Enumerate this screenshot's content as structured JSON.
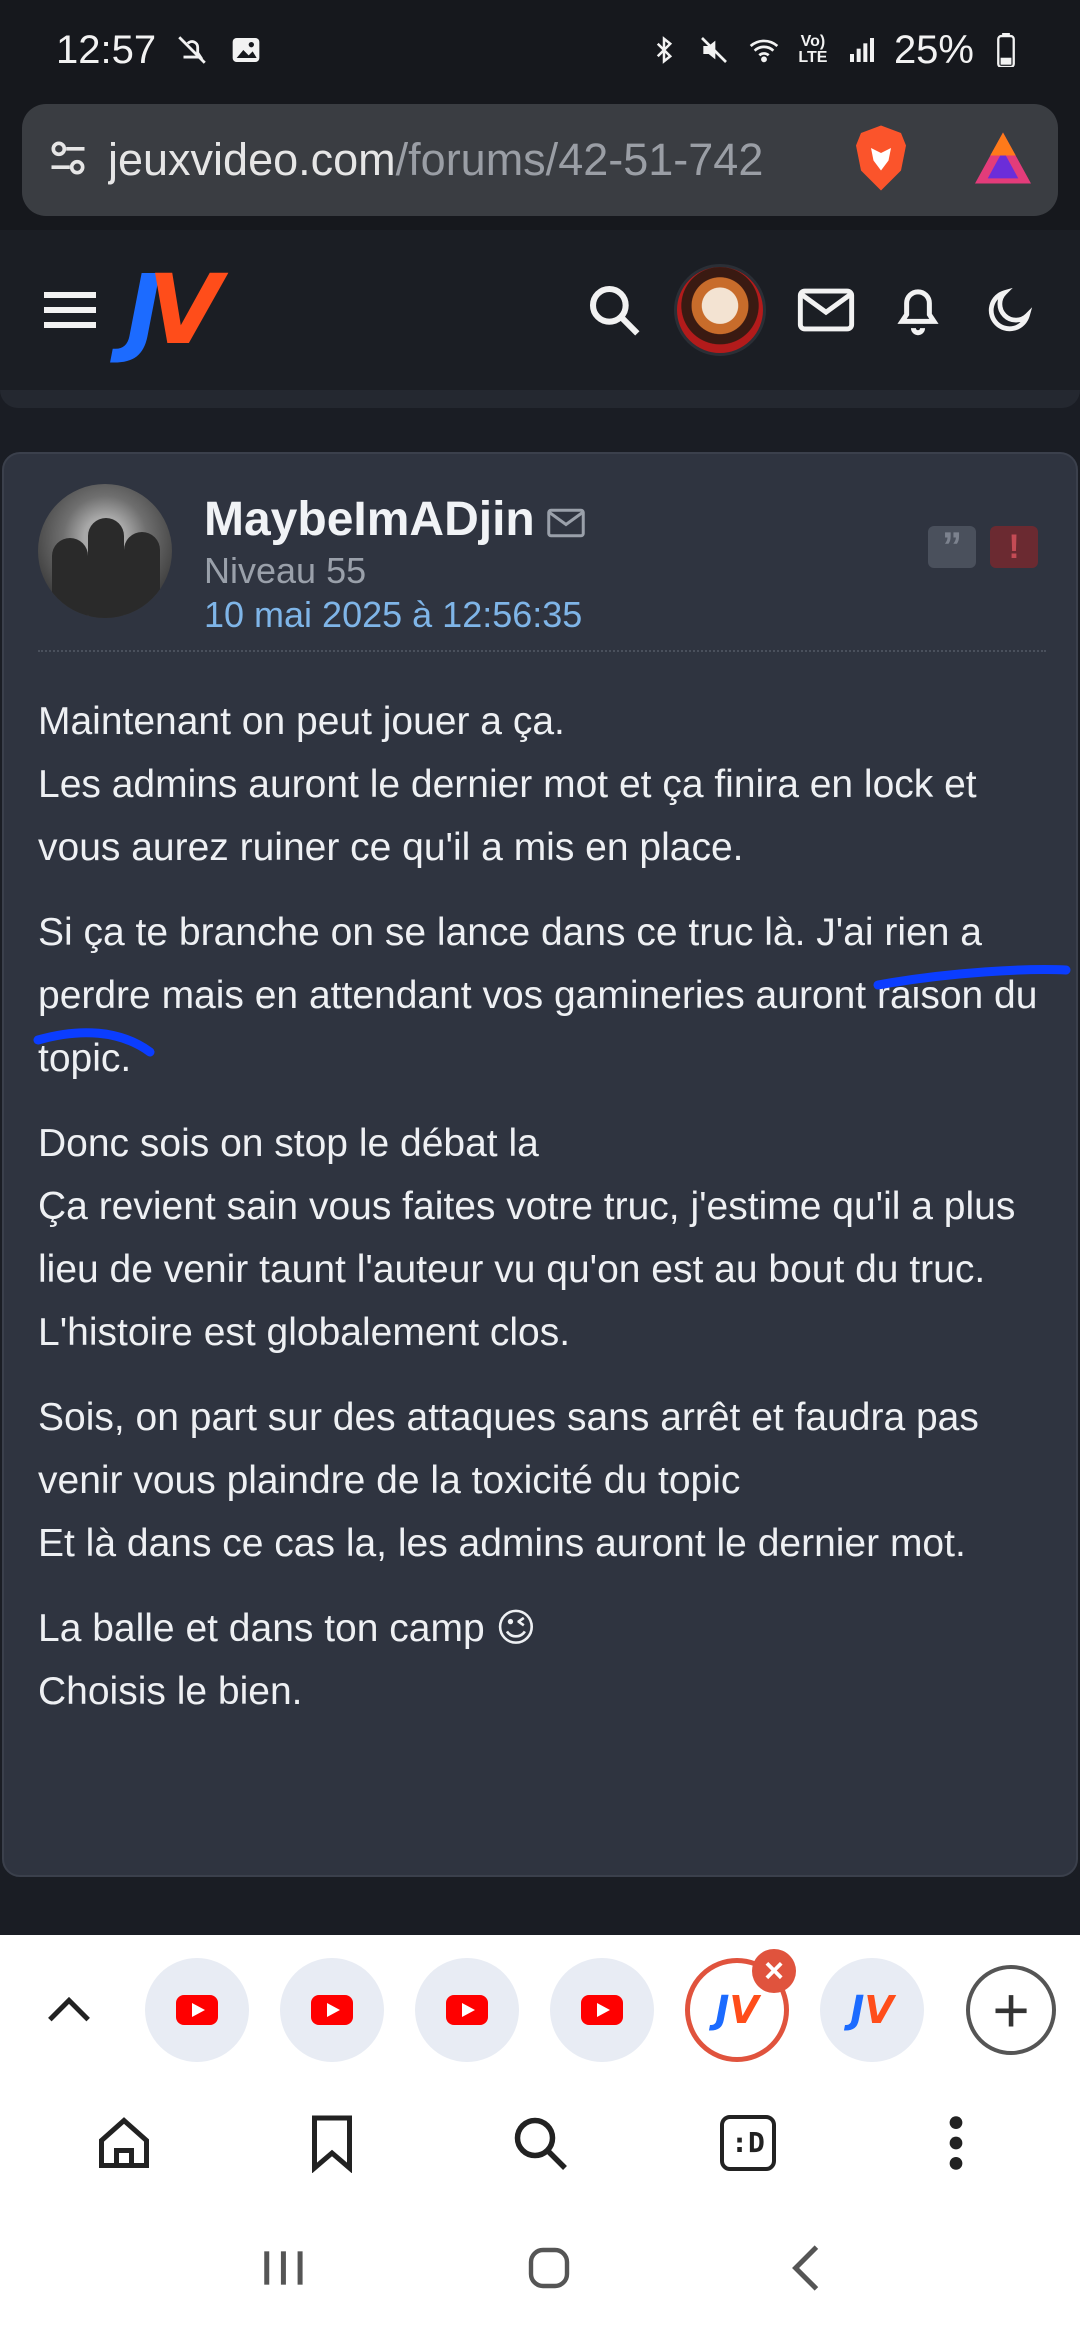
{
  "status_bar": {
    "time": "12:57",
    "battery": "25%",
    "volte": "Vo) LTE"
  },
  "browser": {
    "url_host": "jeuxvideo.com",
    "url_path": "/forums/42-51-742"
  },
  "site": {
    "logo_text_j": "J",
    "logo_text_v": "V"
  },
  "post": {
    "author": "MaybeImADjin",
    "level": "Niveau 55",
    "date": "10 mai 2025 à 12:56:35",
    "quote_label": "”",
    "report_label": "!",
    "paragraphs": [
      "Maintenant on peut jouer a ça.\nLes admins auront le dernier mot et ça finira en lock et vous aurez ruiner ce qu'il a mis en place.",
      "Si ça te branche on se lance dans ce truc là. J'ai rien a perdre mais en attendant vos gamineries auront raison du topic.",
      "Donc sois on stop le débat la\nÇa revient sain vous faites votre truc, j'estime qu'il a plus lieu de venir taunt l'auteur vu qu'on est au bout du truc. L'histoire est globalement clos.",
      "Sois, on part sur des attaques sans arrêt et faudra pas venir vous plaindre de la toxicité du topic\nEt là dans ce cas la, les admins auront le dernier mot.",
      "La balle et dans ton camp 😉\nChoisis le bien."
    ]
  },
  "tabs": {
    "close_label": "×",
    "new_tab_label": "+",
    "items": [
      {
        "icon": "youtube-icon"
      },
      {
        "icon": "youtube-icon"
      },
      {
        "icon": "youtube-icon"
      },
      {
        "icon": "youtube-icon"
      },
      {
        "icon": "jv-icon",
        "active": true
      },
      {
        "icon": "jv-icon"
      }
    ]
  },
  "toolbar": {
    "tabs_count_label": ":D"
  },
  "colors": {
    "accent_blue": "#7fb5e8",
    "jv_orange": "#ff4d1a",
    "jv_blue": "#1c6bff",
    "card_bg": "#2f3440",
    "scribble_blue": "#0b3dff"
  }
}
